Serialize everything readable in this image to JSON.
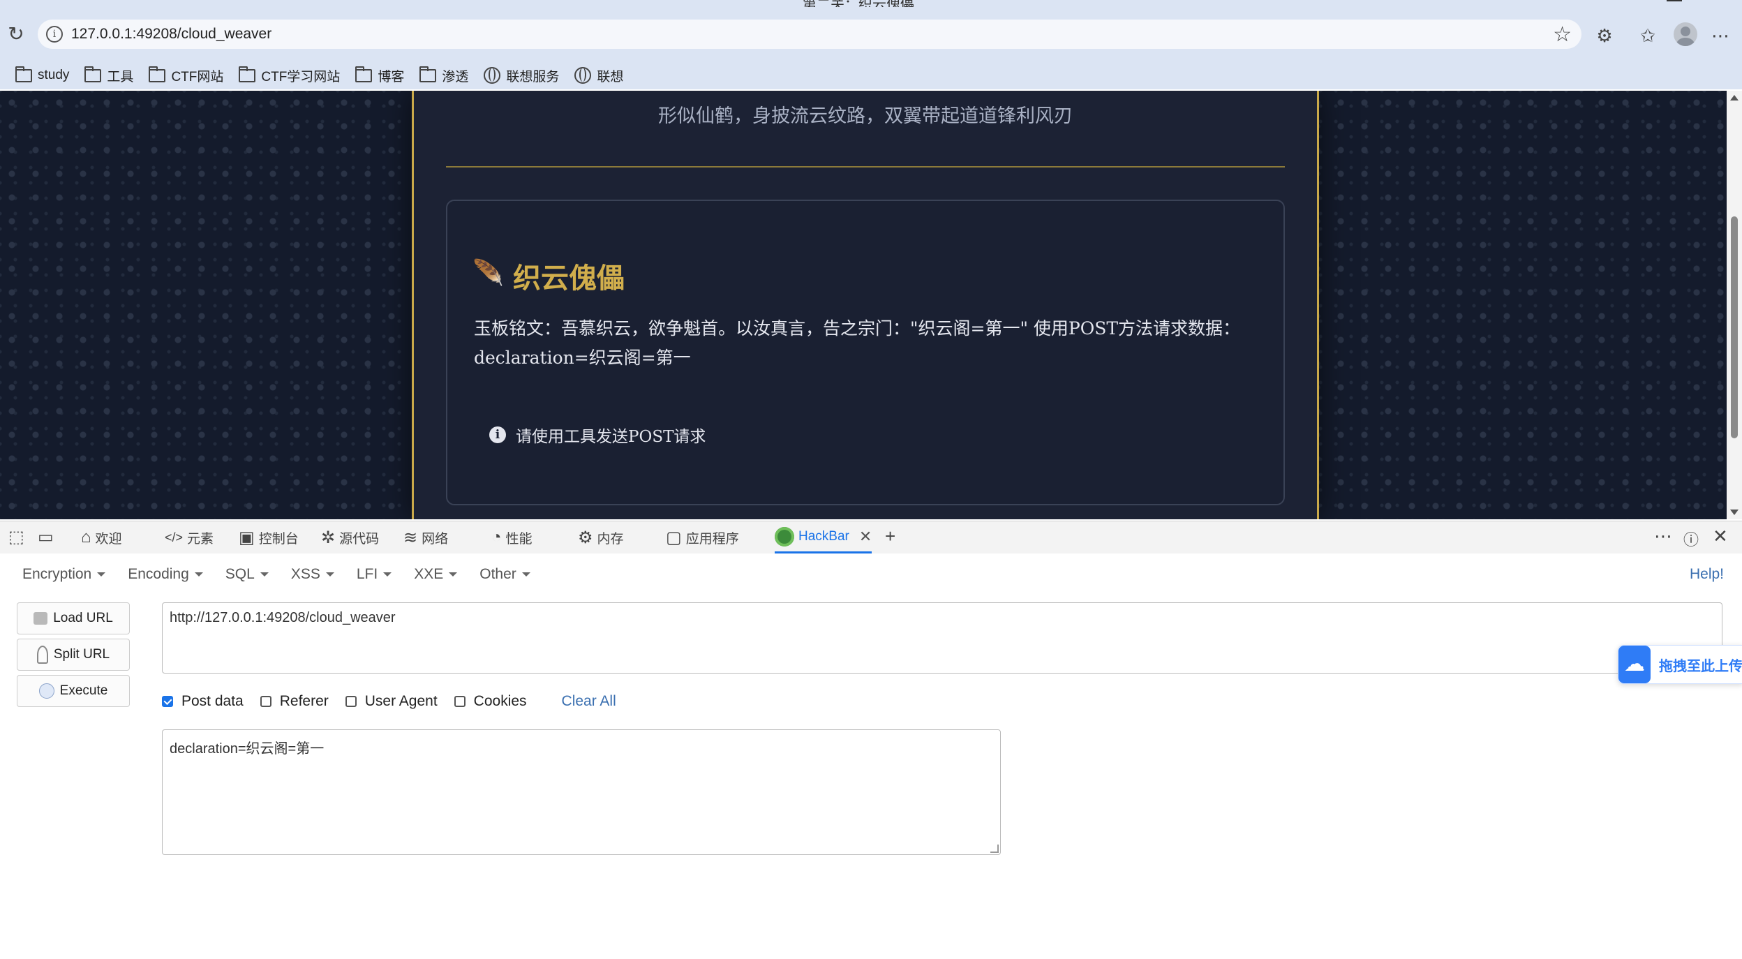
{
  "browser": {
    "window_title": "第二关：织云傀儡",
    "address": "127.0.0.1:49208/cloud_weaver",
    "bookmarks": [
      {
        "label": "study",
        "icon": "folder-icon"
      },
      {
        "label": "工具",
        "icon": "folder-icon"
      },
      {
        "label": "CTF网站",
        "icon": "folder-icon"
      },
      {
        "label": "CTF学习网站",
        "icon": "folder-icon"
      },
      {
        "label": "博客",
        "icon": "folder-icon"
      },
      {
        "label": "渗透",
        "icon": "folder-icon"
      },
      {
        "label": "联想服务",
        "icon": "globe-icon"
      },
      {
        "label": "联想",
        "icon": "globe-icon"
      }
    ]
  },
  "page": {
    "subtitle": "形似仙鹤，身披流云纹路，双翼带起道道锋利风刃",
    "card_title": "织云傀儡",
    "card_body": "玉板铭文：吾慕织云，欲争魁首。以汝真言，告之宗门：\"织云阁=第一\" 使用POST方法请求数据：declaration=织云阁=第一",
    "hint": "请使用工具发送POST请求",
    "accent": "#c9a94a"
  },
  "devtools": {
    "tabs": [
      {
        "label": "欢迎",
        "icon": "home-icon"
      },
      {
        "label": "元素",
        "icon": "code-icon"
      },
      {
        "label": "控制台",
        "icon": "console-icon"
      },
      {
        "label": "源代码",
        "icon": "bug-icon"
      },
      {
        "label": "网络",
        "icon": "wifi-icon"
      },
      {
        "label": "性能",
        "icon": "gauge-icon"
      },
      {
        "label": "内存",
        "icon": "memory-icon"
      },
      {
        "label": "应用程序",
        "icon": "app-icon"
      },
      {
        "label": "HackBar",
        "icon": "hackbar-icon",
        "active": true
      }
    ]
  },
  "hackbar": {
    "menus": [
      "Encryption",
      "Encoding",
      "SQL",
      "XSS",
      "LFI",
      "XXE",
      "Other"
    ],
    "help": "Help!",
    "buttons": {
      "load": "Load URL",
      "split": "Split URL",
      "execute": "Execute"
    },
    "url": "http://127.0.0.1:49208/cloud_weaver",
    "options": {
      "post_data": {
        "label": "Post data",
        "checked": true
      },
      "referer": {
        "label": "Referer",
        "checked": false
      },
      "user_agent": {
        "label": "User Agent",
        "checked": false
      },
      "cookies": {
        "label": "Cookies",
        "checked": false
      },
      "clear_all": "Clear All"
    },
    "post_body": "declaration=织云阁=第一"
  },
  "upload_widget": {
    "label": "拖拽至此上传"
  }
}
